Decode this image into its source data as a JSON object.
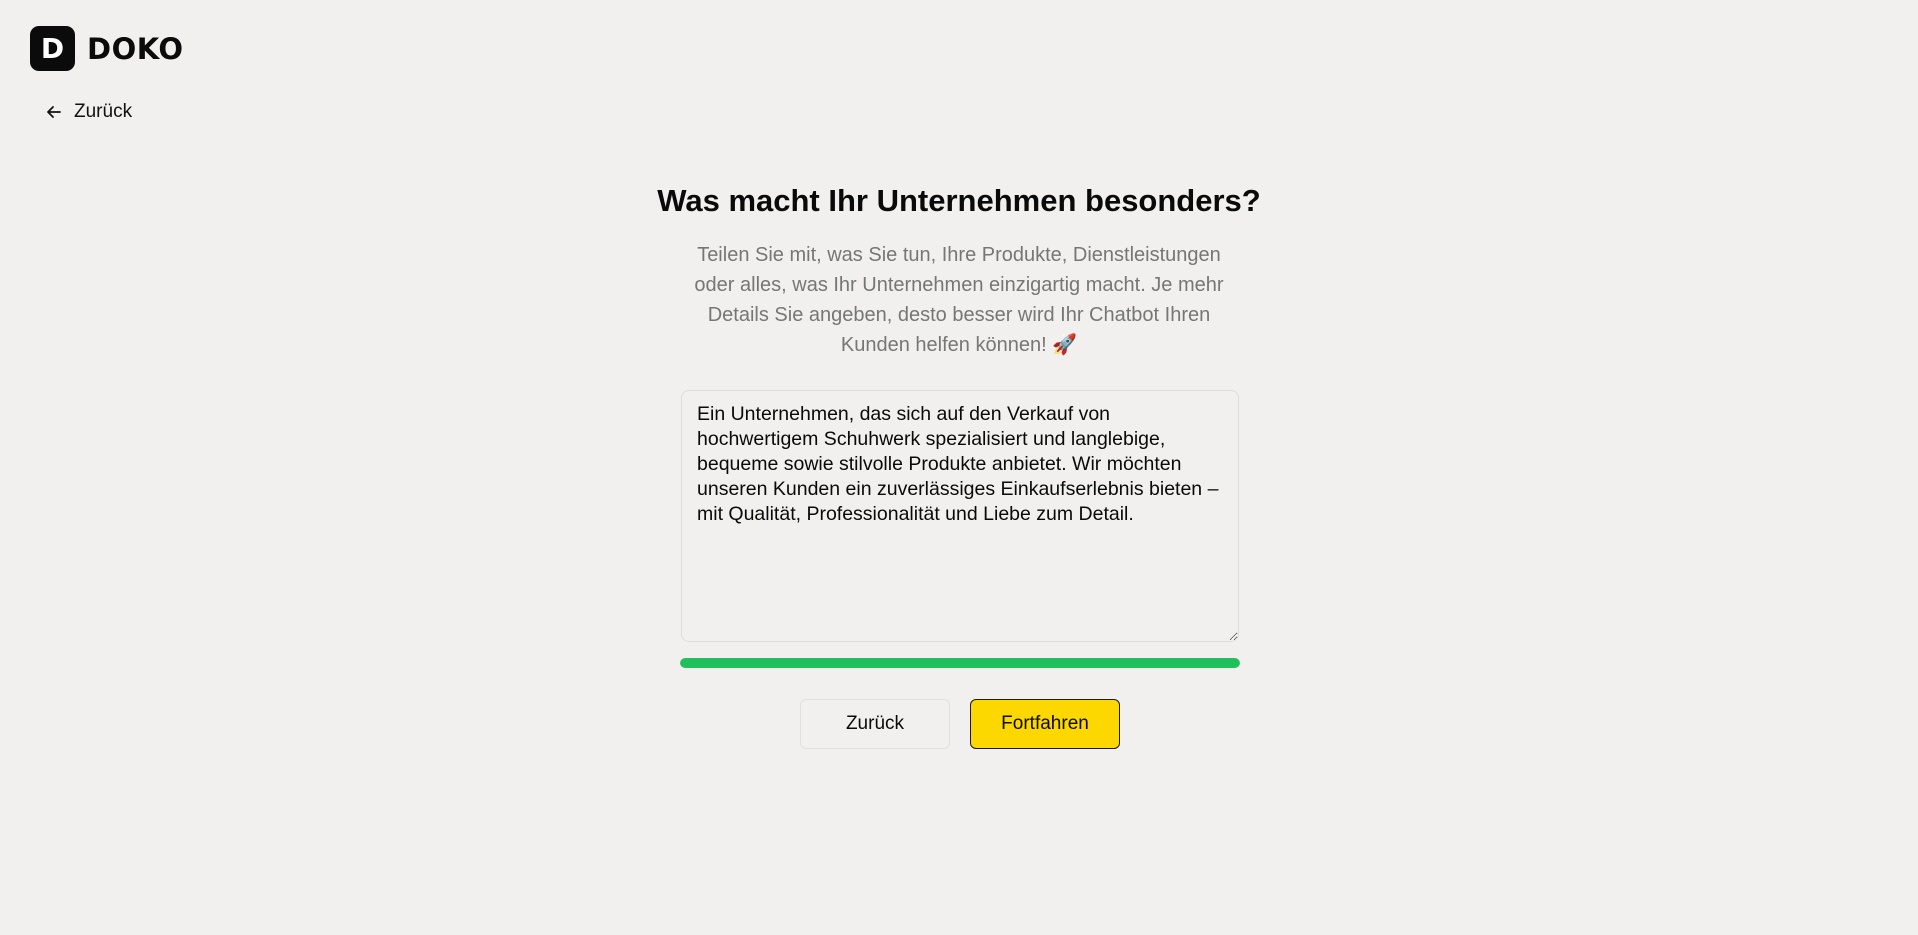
{
  "brand": {
    "logo_letter": "D",
    "name": "DOKO"
  },
  "nav": {
    "back_label": "Zurück"
  },
  "main": {
    "title": "Was macht Ihr Unternehmen besonders?",
    "subtitle": "Teilen Sie mit, was Sie tun, Ihre Produkte, Dienstleistungen oder alles, was Ihr Unternehmen einzigartig macht. Je mehr Details Sie angeben, desto besser wird Ihr Chatbot Ihren Kunden helfen können! 🚀",
    "description_value": "Ein Unternehmen, das sich auf den Verkauf von hochwertigem Schuhwerk spezialisiert und langlebige, bequeme sowie stilvolle Produkte anbietet. Wir möchten unseren Kunden ein zuverlässiges Einkaufserlebnis bieten – mit Qualität, Professionalität und Liebe zum Detail.",
    "progress_percent": 100,
    "progress_color": "#22c05c"
  },
  "actions": {
    "back_label": "Zurück",
    "continue_label": "Fortfahren",
    "continue_color": "#fcd800"
  }
}
